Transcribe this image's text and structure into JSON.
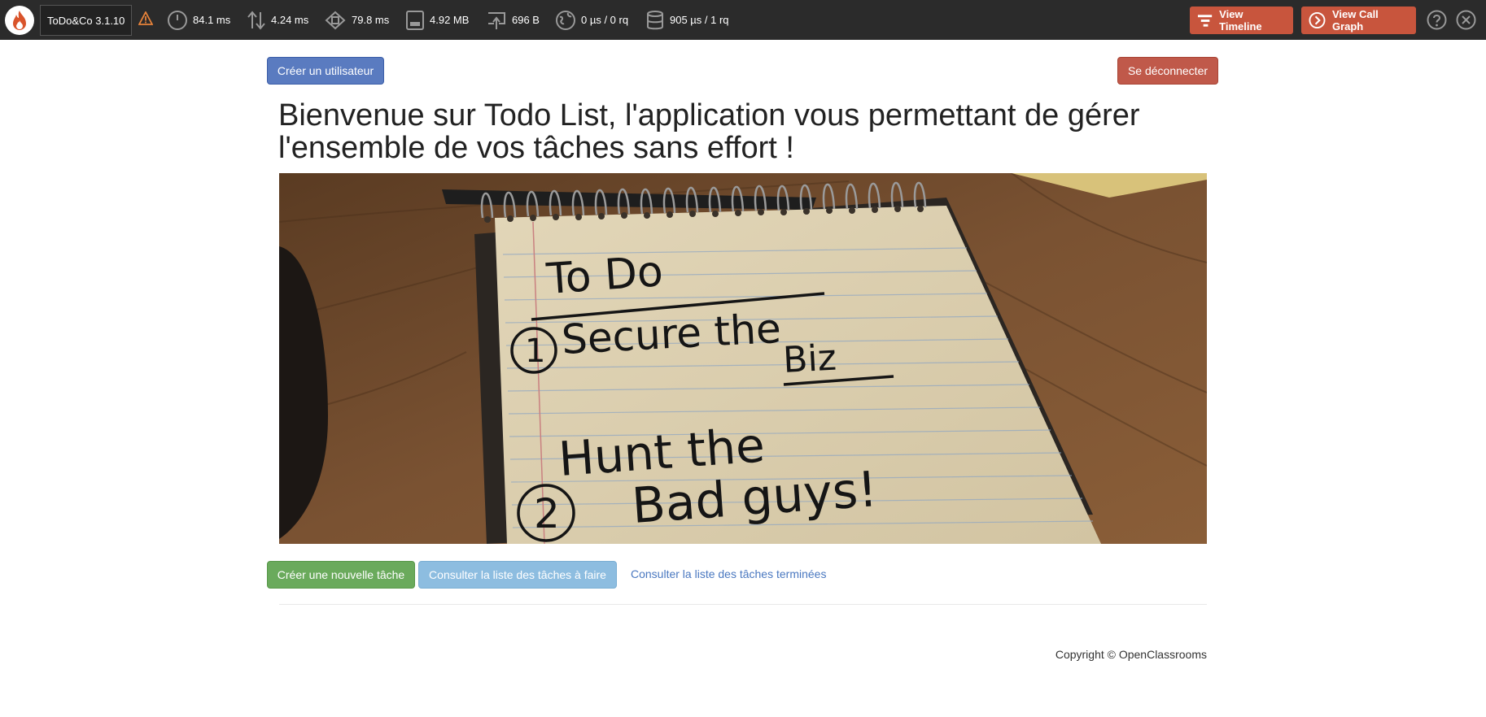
{
  "toolbar": {
    "app_name": "ToDo&Co 3.1.10",
    "metrics": {
      "time": "84.1 ms",
      "io": "4.24 ms",
      "cpu": "79.8 ms",
      "memory": "4.92 MB",
      "network": "696 B",
      "http": "0 µs / 0 rq",
      "sql": "905 µs / 1 rq"
    },
    "view_timeline_label": "View Timeline",
    "view_call_graph_label": "View Call Graph",
    "accent_color": "#c8553d"
  },
  "header": {
    "create_user_label": "Créer un utilisateur",
    "logout_label": "Se déconnecter"
  },
  "main": {
    "title": "Bienvenue sur Todo List, l'application vous permettant de gérer l'ensemble de vos tâches sans effort !",
    "hero_image": {
      "notes": {
        "heading": "To Do",
        "line1": "Secure the",
        "line1b": "Biz",
        "line2": "Hunt the",
        "line2b": "Bad guys!",
        "num1": "1",
        "num2": "2"
      }
    },
    "actions": {
      "create_task_label": "Créer une nouvelle tâche",
      "todo_list_label": "Consulter la liste des tâches à faire",
      "done_list_label": "Consulter la liste des tâches terminées"
    }
  },
  "footer": {
    "copyright": "Copyright © OpenClassrooms"
  }
}
